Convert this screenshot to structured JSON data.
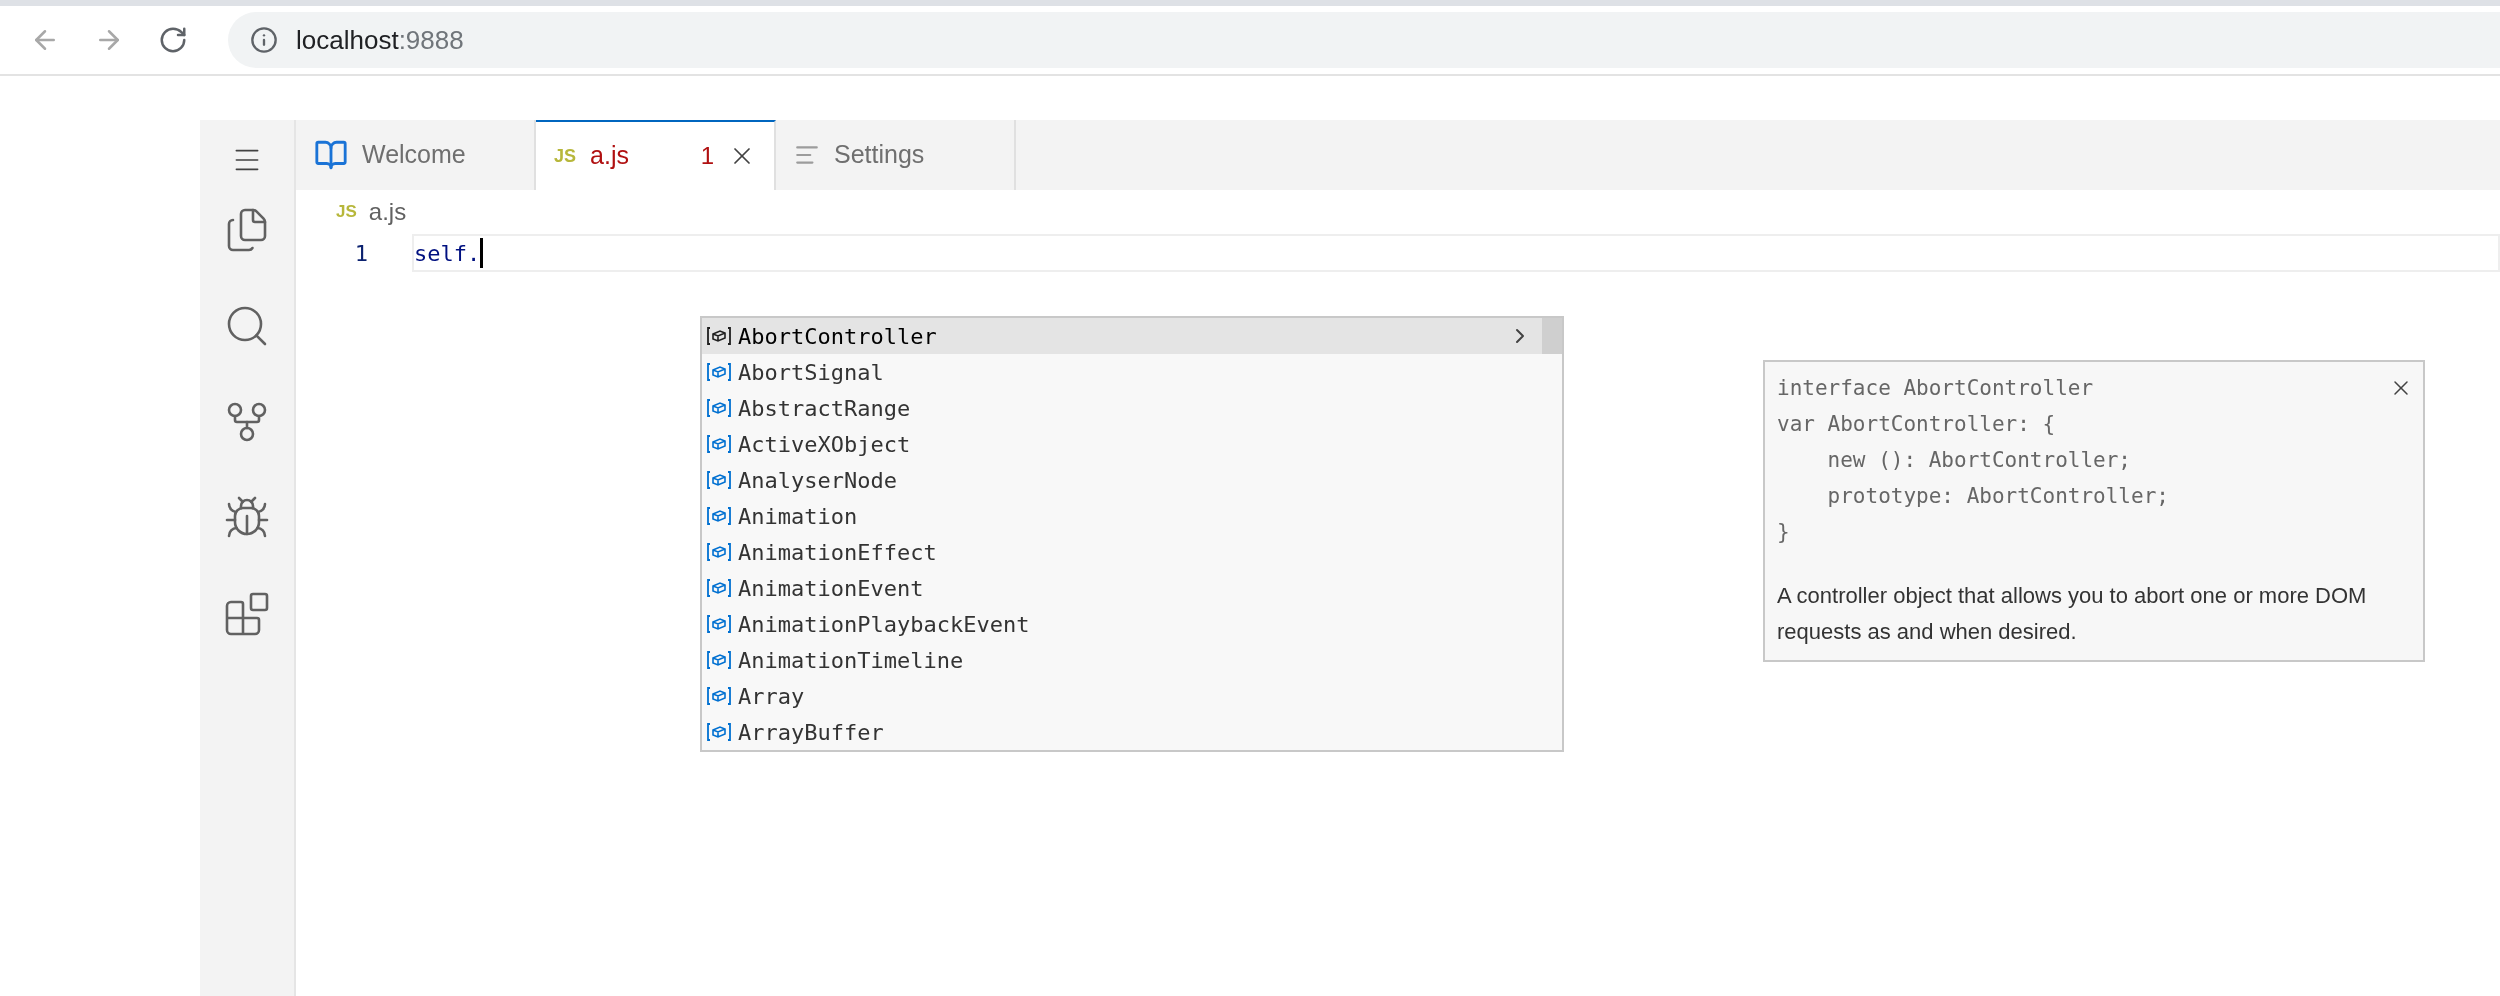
{
  "browser": {
    "url_host": "localhost",
    "url_port": ":9888"
  },
  "tabs": [
    {
      "kind": "welcome",
      "label": "Welcome",
      "selected": false
    },
    {
      "kind": "js",
      "icon_text": "JS",
      "label": "a.js",
      "badge": "1",
      "selected": true
    },
    {
      "kind": "settings",
      "label": "Settings",
      "selected": false
    }
  ],
  "breadcrumb": {
    "icon_text": "JS",
    "label": "a.js"
  },
  "editor": {
    "lines": [
      {
        "number": "1",
        "code": "self."
      }
    ]
  },
  "suggest": {
    "items": [
      {
        "label": "AbortController",
        "selected": true
      },
      {
        "label": "AbortSignal",
        "selected": false
      },
      {
        "label": "AbstractRange",
        "selected": false
      },
      {
        "label": "ActiveXObject",
        "selected": false
      },
      {
        "label": "AnalyserNode",
        "selected": false
      },
      {
        "label": "Animation",
        "selected": false
      },
      {
        "label": "AnimationEffect",
        "selected": false
      },
      {
        "label": "AnimationEvent",
        "selected": false
      },
      {
        "label": "AnimationPlaybackEvent",
        "selected": false
      },
      {
        "label": "AnimationTimeline",
        "selected": false
      },
      {
        "label": "Array",
        "selected": false
      },
      {
        "label": "ArrayBuffer",
        "selected": false
      }
    ]
  },
  "hover": {
    "code_lines": [
      "interface AbortController",
      "var AbortController: {",
      "    new (): AbortController;",
      "    prototype: AbortController;",
      "}"
    ],
    "doc": "A controller object that allows you to abort one or more DOM requests as and when desired."
  }
}
